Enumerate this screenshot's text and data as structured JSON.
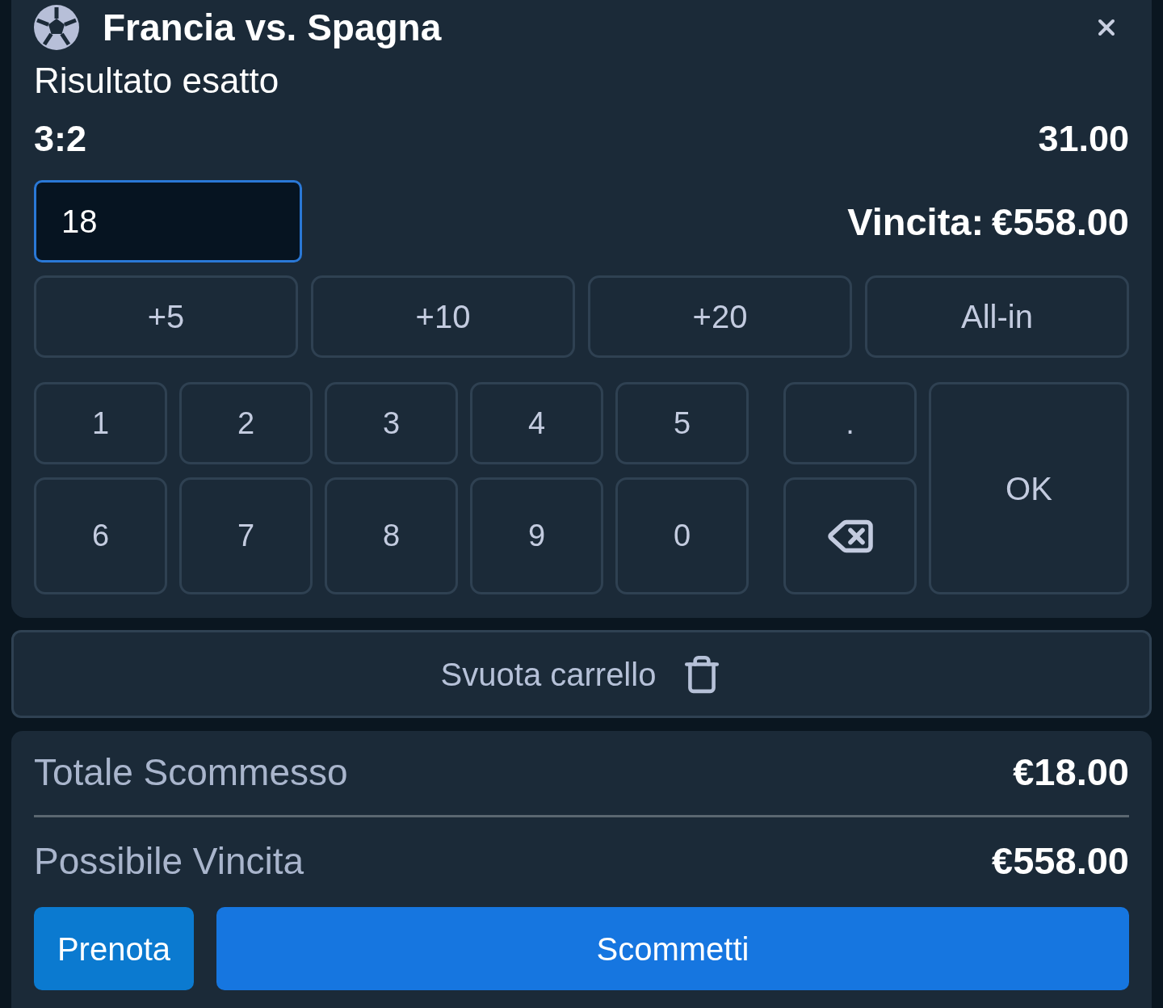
{
  "header": {
    "title": "Francia vs. Spagna"
  },
  "market": "Risultato esatto",
  "selection": {
    "outcome": "3:2",
    "odds": "31.00"
  },
  "stake": {
    "value": "18",
    "focused": true
  },
  "potential_win": {
    "label": "Vincita:",
    "amount": "€558.00"
  },
  "quick_amounts": [
    "+5",
    "+10",
    "+20",
    "All-in"
  ],
  "keypad": {
    "digit_rows": [
      [
        "1",
        "2",
        "3",
        "4",
        "5"
      ],
      [
        "6",
        "7",
        "8",
        "9",
        "0"
      ]
    ],
    "decimal_key": ".",
    "ok_key": "OK"
  },
  "clear_cart": {
    "label": "Svuota carrello"
  },
  "summary": [
    {
      "label": "Totale Scommesso",
      "value": "€18.00"
    },
    {
      "label": "Possibile Vincita",
      "value": "€558.00"
    }
  ],
  "actions": [
    {
      "label": "Prenota",
      "kind": "secondary"
    },
    {
      "label": "Scommetti",
      "kind": "primary"
    }
  ]
}
